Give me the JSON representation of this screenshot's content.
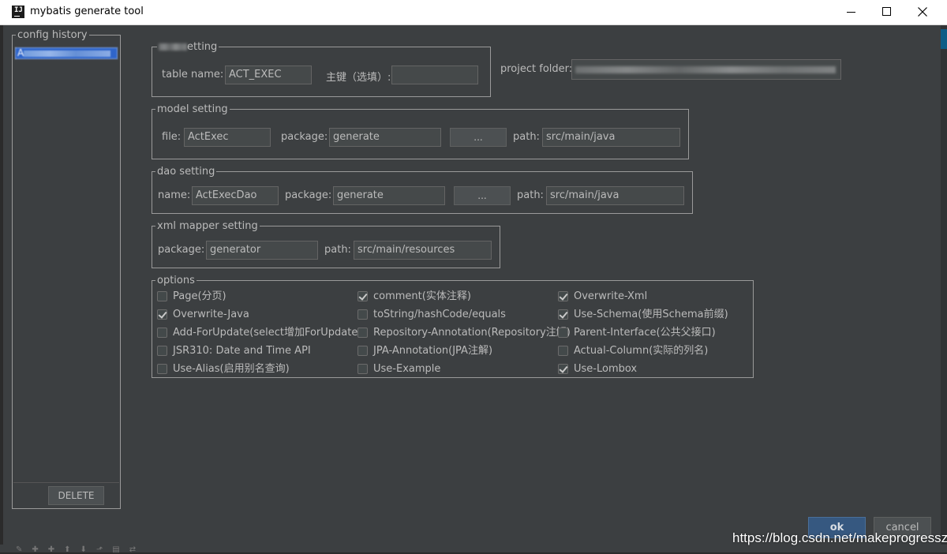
{
  "window": {
    "title": "mybatis generate tool",
    "app_icon_text": "IJ"
  },
  "history": {
    "legend": "config history",
    "selected_item_first_char": "A",
    "delete_label": "DELETE"
  },
  "table_setting": {
    "legend_visible": "etting",
    "table_name_label": "table  name:",
    "table_name_value": "ACT_EXEC",
    "primary_key_label": "主键（选填）:",
    "primary_key_value": ""
  },
  "project": {
    "folder_label": "project folder:",
    "folder_value": ""
  },
  "model_setting": {
    "legend": "model setting",
    "file_label": "file:",
    "file_value": "ActExec",
    "package_label": "package:",
    "package_value": "generate",
    "browse_label": "...",
    "path_label": "path:",
    "path_value": "src/main/java"
  },
  "dao_setting": {
    "legend": "dao setting",
    "name_label": "name:",
    "name_value": "ActExecDao",
    "package_label": "package:",
    "package_value": "generate",
    "browse_label": "...",
    "path_label": "path:",
    "path_value": "src/main/java"
  },
  "xml_setting": {
    "legend": "xml mapper setting",
    "package_label": "package:",
    "package_value": "generator",
    "path_label": "path:",
    "path_value": "src/main/resources"
  },
  "options": {
    "legend": "options",
    "items": [
      {
        "label": "Page(分页)",
        "checked": false
      },
      {
        "label": "comment(实体注释)",
        "checked": true
      },
      {
        "label": "Overwrite-Xml",
        "checked": true
      },
      {
        "label": "Overwrite-Java",
        "checked": true
      },
      {
        "label": "toString/hashCode/equals",
        "checked": false
      },
      {
        "label": "Use-Schema(使用Schema前缀)",
        "checked": true
      },
      {
        "label": "Add-ForUpdate(select增加ForUpdate)",
        "checked": false
      },
      {
        "label": "Repository-Annotation(Repository注解)",
        "checked": false
      },
      {
        "label": "Parent-Interface(公共父接口)",
        "checked": false
      },
      {
        "label": "JSR310: Date and Time API",
        "checked": false
      },
      {
        "label": "JPA-Annotation(JPA注解)",
        "checked": false
      },
      {
        "label": "Actual-Column(实际的列名)",
        "checked": false
      },
      {
        "label": "Use-Alias(启用别名查询)",
        "checked": false
      },
      {
        "label": "Use-Example",
        "checked": false
      },
      {
        "label": "Use-Lombox",
        "checked": true
      }
    ]
  },
  "actions": {
    "ok_label": "ok",
    "cancel_label": "cancel"
  },
  "watermark": "https://blog.csdn.net/makeprogresszb",
  "colors": {
    "dialog_bg": "#3c3f41",
    "input_bg": "#45494a",
    "text": "#bbbbbb",
    "selection": "#2f65ca",
    "ok_button": "#365880"
  }
}
